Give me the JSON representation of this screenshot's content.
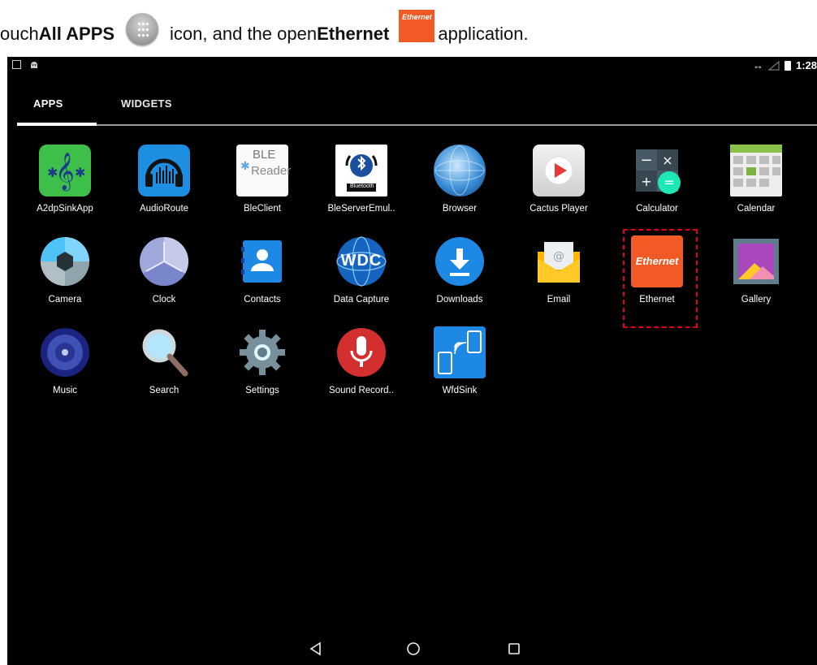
{
  "caption": {
    "prefix": "ouch ",
    "all_apps": "All APPS",
    "middle": "icon, and the open ",
    "ethernet": "Ethernet",
    "suffix": "application.",
    "ethernet_icon_text": "Ethernet"
  },
  "statusbar": {
    "time": "1:28",
    "icons": [
      "screenshot-icon",
      "android-icon",
      "data-arrows-icon",
      "no-signal-icon",
      "battery-icon"
    ]
  },
  "tabs": [
    {
      "label": "APPS",
      "active": true
    },
    {
      "label": "WIDGETS",
      "active": false
    }
  ],
  "apps": [
    {
      "label": "A2dpSinkApp",
      "icon": "a2dp-sink-icon"
    },
    {
      "label": "AudioRoute",
      "icon": "audio-route-icon"
    },
    {
      "label": "BleClient",
      "icon": "ble-client-icon",
      "icon_text_1": "BLE",
      "icon_text_2": "Reader"
    },
    {
      "label": "BleServerEmul..",
      "icon": "ble-server-icon",
      "icon_text": "Bluetooth"
    },
    {
      "label": "Browser",
      "icon": "browser-icon"
    },
    {
      "label": "Cactus Player",
      "icon": "cactus-player-icon"
    },
    {
      "label": "Calculator",
      "icon": "calculator-icon"
    },
    {
      "label": "Calendar",
      "icon": "calendar-icon"
    },
    {
      "label": "Camera",
      "icon": "camera-icon"
    },
    {
      "label": "Clock",
      "icon": "clock-icon"
    },
    {
      "label": "Contacts",
      "icon": "contacts-icon"
    },
    {
      "label": "Data Capture",
      "icon": "data-capture-icon",
      "icon_text": "WDC"
    },
    {
      "label": "Downloads",
      "icon": "downloads-icon"
    },
    {
      "label": "Email",
      "icon": "email-icon"
    },
    {
      "label": "Ethernet",
      "icon": "ethernet-icon",
      "icon_text": "Ethernet"
    },
    {
      "label": "Gallery",
      "icon": "gallery-icon"
    },
    {
      "label": "Music",
      "icon": "music-icon"
    },
    {
      "label": "Search",
      "icon": "search-icon"
    },
    {
      "label": "Settings",
      "icon": "settings-icon"
    },
    {
      "label": "Sound Record..",
      "icon": "sound-recorder-icon"
    },
    {
      "label": "WfdSink",
      "icon": "wfd-sink-icon"
    }
  ],
  "colors": {
    "highlight": "#e0001a",
    "ethernet_orange": "#f15a24"
  }
}
